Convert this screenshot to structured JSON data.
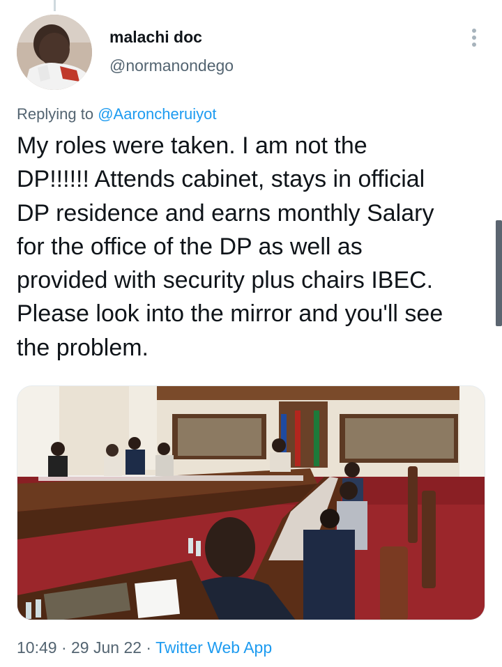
{
  "author": {
    "display_name": "malachi doc",
    "handle": "@normanondego"
  },
  "reply": {
    "prefix": "Replying to ",
    "mention": "@Aaroncheruiyot"
  },
  "tweet": {
    "lines": [
      "My roles were taken. I am not the",
      "DP!!!!!! Attends cabinet, stays in official",
      "DP residence and earns monthly Salary",
      "for the office of the DP as well as",
      "provided with security plus chairs IBEC.",
      "Please look into the mirror and you'll see",
      "the problem."
    ]
  },
  "meta": {
    "time": "10:49",
    "separator": " · ",
    "date": "29 Jun 22",
    "source": "Twitter Web App"
  },
  "icons": {
    "more": "more-vertical-icon"
  },
  "colors": {
    "link": "#1d9bf0",
    "secondary_text": "#536471",
    "primary_text": "#0f1419"
  }
}
